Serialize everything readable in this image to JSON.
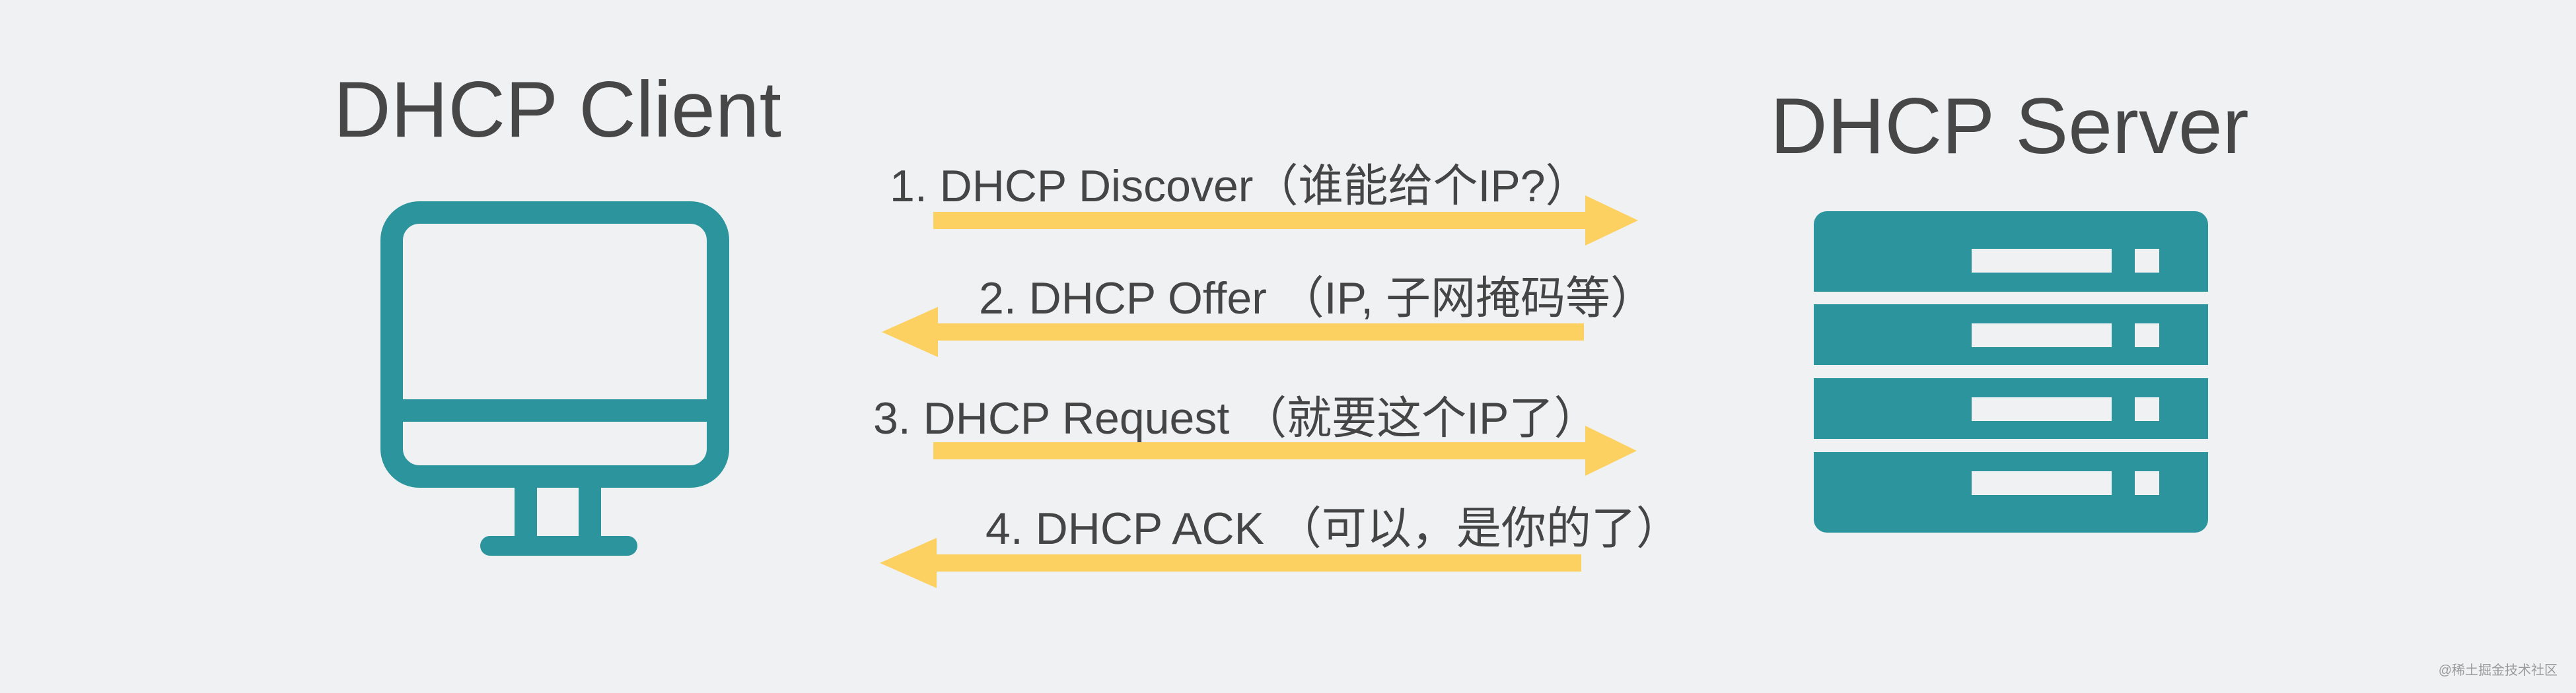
{
  "client": {
    "title": "DHCP Client",
    "icon": "computer-monitor-icon"
  },
  "server": {
    "title": "DHCP Server",
    "icon": "server-rack-icon"
  },
  "messages": [
    {
      "label": "1. DHCP Discover（谁能给个IP?）",
      "direction": "client-to-server"
    },
    {
      "label": "2. DHCP Offer （IP, 子网掩码等）",
      "direction": "server-to-client"
    },
    {
      "label": "3. DHCP Request （就要这个IP了）",
      "direction": "client-to-server"
    },
    {
      "label": "4. DHCP ACK （可以，是你的了）",
      "direction": "server-to-client"
    }
  ],
  "colors": {
    "background": "#eff1f3",
    "icon": "#2c949c",
    "arrow": "#fdd161",
    "text": "#454545"
  },
  "watermark": "@稀土掘金技术社区"
}
